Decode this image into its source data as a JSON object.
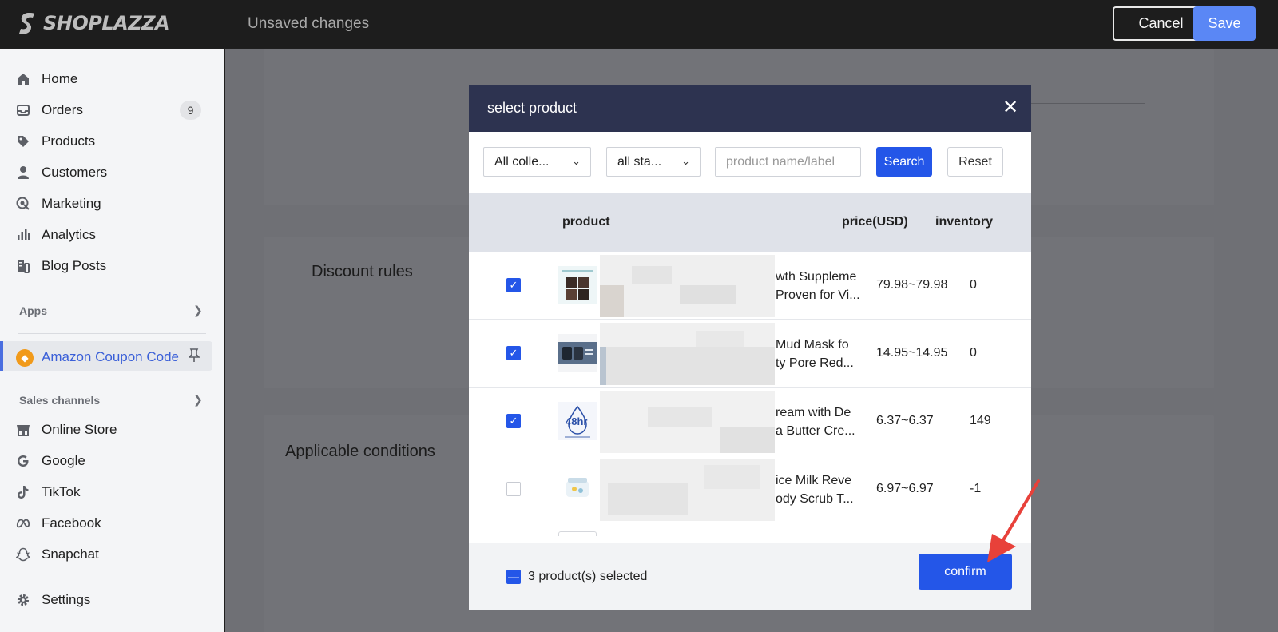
{
  "topbar": {
    "brand": "SHOPLAZZA",
    "status": "Unsaved changes",
    "cancel_label": "Cancel",
    "save_label": "Save"
  },
  "sidebar": {
    "items": [
      {
        "label": "Home",
        "icon": "home-icon"
      },
      {
        "label": "Orders",
        "icon": "inbox-icon",
        "badge": "9"
      },
      {
        "label": "Products",
        "icon": "tag-icon"
      },
      {
        "label": "Customers",
        "icon": "person-icon"
      },
      {
        "label": "Marketing",
        "icon": "target-icon"
      },
      {
        "label": "Analytics",
        "icon": "bar-chart-icon"
      },
      {
        "label": "Blog Posts",
        "icon": "document-icon"
      }
    ],
    "apps_label": "Apps",
    "active_app": "Amazon Coupon Code",
    "sales_label": "Sales channels",
    "channels": [
      {
        "label": "Online Store",
        "icon": "store-icon"
      },
      {
        "label": "Google",
        "icon": "google-icon"
      },
      {
        "label": "TikTok",
        "icon": "tiktok-icon"
      },
      {
        "label": "Facebook",
        "icon": "meta-icon"
      },
      {
        "label": "Snapchat",
        "icon": "snapchat-icon"
      }
    ],
    "settings_label": "Settings"
  },
  "background": {
    "discount_rules": "Discount rules",
    "applicable_conditions": "Applicable conditions"
  },
  "modal": {
    "title": "select product",
    "collection_filter": "All colle...",
    "status_filter": "all sta...",
    "search_placeholder": "product name/label",
    "search_label": "Search",
    "reset_label": "Reset",
    "columns": {
      "product": "product",
      "price": "price(USD)",
      "inventory": "inventory"
    },
    "rows": [
      {
        "checked": true,
        "name_line1": "wth Suppleme",
        "name_line2": "Proven for Vi...",
        "price": "79.98~79.98",
        "inventory": "0"
      },
      {
        "checked": true,
        "name_line1": "Mud Mask fo",
        "name_line2": "ty Pore Red...",
        "price": "14.95~14.95",
        "inventory": "0"
      },
      {
        "checked": true,
        "name_line1": "ream with De",
        "name_line2": "a Butter Cre...",
        "price": "6.37~6.37",
        "inventory": "149"
      },
      {
        "checked": false,
        "name_line1": "ice Milk Reve",
        "name_line2": "ody Scrub T...",
        "price": "6.97~6.97",
        "inventory": "-1"
      }
    ],
    "thumb3_text": "48hr",
    "selected_text": "3 product(s) selected",
    "confirm_label": "confirm"
  },
  "colors": {
    "accent": "#2456e8",
    "modal_header": "#2d3350",
    "annotation_arrow": "#e8413a"
  }
}
